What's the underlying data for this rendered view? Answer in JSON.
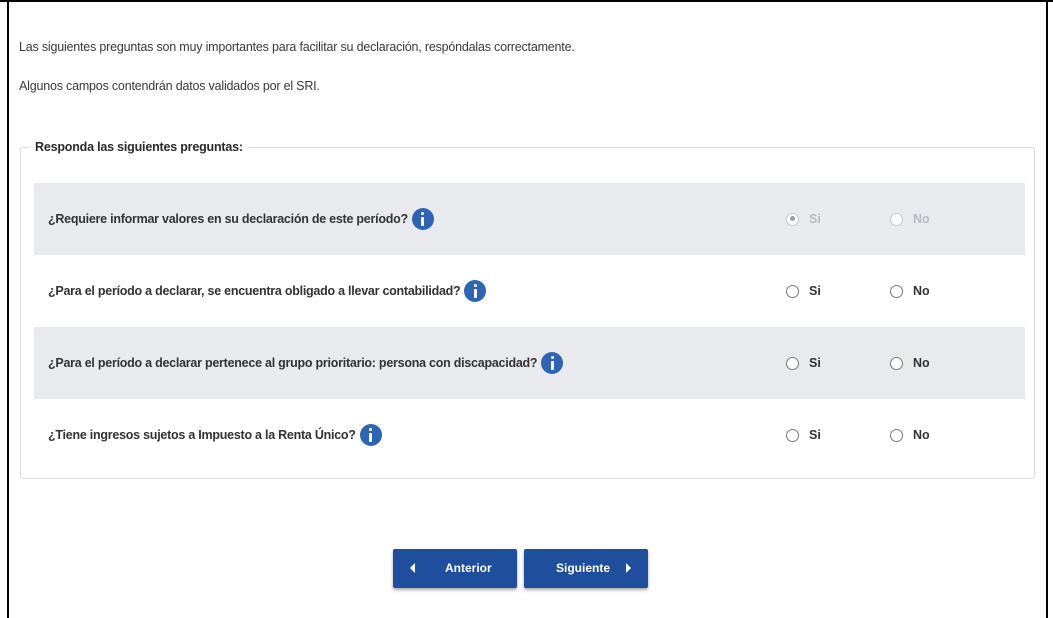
{
  "intro": {
    "line1": "Las siguientes preguntas son muy importantes para facilitar su declaración, respóndalas correctamente.",
    "line2": "Algunos campos contendrán datos validados por el SRI."
  },
  "questions_section": {
    "legend": "Responda las siguientes preguntas:",
    "questions": [
      {
        "text": "¿Requiere informar valores en su declaración de este período?",
        "yes_label": "Si",
        "no_label": "No",
        "selected": "Si",
        "disabled": true
      },
      {
        "text": "¿Para el período a declarar, se encuentra obligado a llevar contabilidad?",
        "yes_label": "Si",
        "no_label": "No",
        "selected": null,
        "disabled": false
      },
      {
        "text": "¿Para el período a declarar pertenece al grupo prioritario: persona con discapacidad?",
        "yes_label": "Si",
        "no_label": "No",
        "selected": null,
        "disabled": false
      },
      {
        "text": "¿Tiene ingresos sujetos a Impuesto a la Renta Único?",
        "yes_label": "Si",
        "no_label": "No",
        "selected": null,
        "disabled": false
      }
    ]
  },
  "nav": {
    "prev_label": "Anterior",
    "next_label": "Siguiente"
  },
  "colors": {
    "primary_button": "#1f4e9c",
    "info_icon": "#2e64b2",
    "shaded_row": "#e8eaee"
  }
}
